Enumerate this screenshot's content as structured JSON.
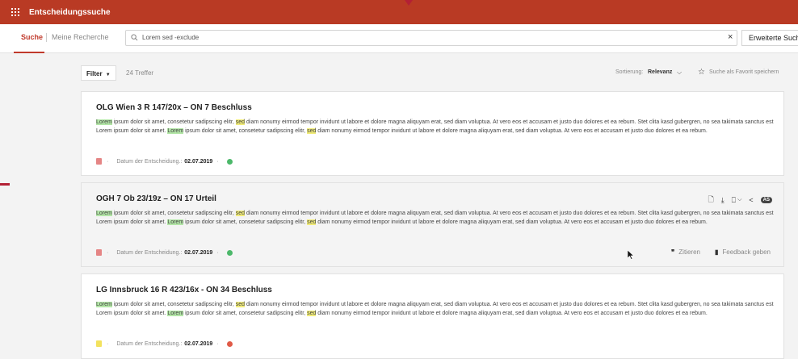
{
  "app": {
    "title": "Entscheidungssuche"
  },
  "nav": {
    "tab_search": "Suche",
    "tab_research": "Meine Recherche"
  },
  "search": {
    "query": "Lorem sed -exclude",
    "clear": "×",
    "advanced_label": "Erweiterte Suche"
  },
  "toolbar": {
    "filter_label": "Filter",
    "filter_caret": "▼",
    "result_count": "24 Treffer",
    "sort_label": "Sortierung:",
    "sort_value": "Relevanz",
    "sort_chevron": "⌵",
    "favorite_star": "☆",
    "favorite_label": "Suche als Favorit speichern"
  },
  "snippet": {
    "w_lorem": "Lorem",
    "w_sed": "sed",
    "seg1": " ipsum dolor sit amet, consetetur sadipscing elitr, ",
    "seg2": " diam nonumy eirmod tempor invidunt ut labore et dolore magna aliquyam erat, sed diam voluptua. At vero eos et accusam et justo duo dolores et ea rebum. Stet clita kasd gubergren, no sea takimata sanctus est Lorem ipsum dolor sit amet. ",
    "seg3": " ipsum dolor sit amet, consetetur sadipscing elitr, ",
    "seg4": " diam nonumy eirmod tempor invidunt ut labore et dolore magna aliquyam erat, sed diam voluptua. At vero eos et accusam et justo duo dolores et ea rebum."
  },
  "meta": {
    "separator": "·",
    "date_label": "Datum der Entscheidung.:"
  },
  "results": [
    {
      "title": "OLG Wien 3 R 147/20x – ON 7 Beschluss",
      "date": "02.07.2019",
      "badge_color": "#e58585",
      "status_color": "#4cb86a"
    },
    {
      "title": "OGH 7 Ob 23/19z – ON 17 Urteil",
      "date": "02.07.2019",
      "badge_color": "#e58585",
      "status_color": "#4cb86a"
    },
    {
      "title": "LG Innsbruck 16 R 423/16x - ON 34 Beschluss",
      "date": "02.07.2019",
      "badge_color": "#f3e25e",
      "status_color": "#e05a47"
    }
  ],
  "card_icons": {
    "document": "🗋",
    "download": "⤓",
    "bookmark": "⎕",
    "bookmark_caret": "⌵",
    "share": "<",
    "badge": "AS"
  },
  "actions": {
    "cite_icon": "❞",
    "cite": "Zitieren",
    "feedback_icon": "▮",
    "feedback": "Feedback geben"
  },
  "colors": {
    "brand": "#b93a24",
    "highlight_green": "#b3e6a7",
    "highlight_yellow": "#f1ec7a"
  }
}
